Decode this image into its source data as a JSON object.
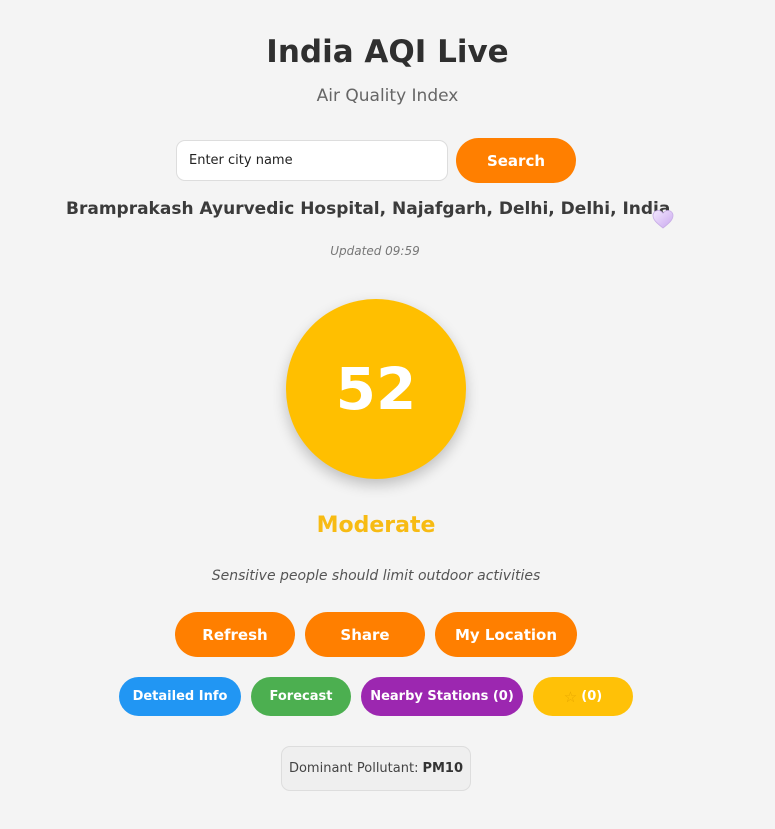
{
  "header": {
    "title": "India AQI Live",
    "subtitle": "Air Quality Index"
  },
  "search": {
    "placeholder": "Enter city name",
    "button_label": "Search"
  },
  "station": {
    "name": "Bramprakash Ayurvedic Hospital, Najafgarh, Delhi, Delhi, India",
    "favorite_icon": "heart-icon",
    "updated": "Updated 09:59"
  },
  "aqi": {
    "value": "52",
    "level": "Moderate",
    "advice": "Sensitive people should limit outdoor activities",
    "color": "#ffbf00",
    "level_color": "#f7bb13"
  },
  "actions": {
    "refresh": "Refresh",
    "share": "Share",
    "my_location": "My Location"
  },
  "links": {
    "detailed_info": "Detailed Info",
    "forecast": "Forecast",
    "nearby_stations": "Nearby Stations (0)",
    "favorites_icon": "star-icon",
    "favorites_star": "☆",
    "favorites_count": "(0)"
  },
  "pollutant": {
    "label": "Dominant Pollutant:",
    "value": "PM10"
  },
  "colors": {
    "primary": "#ff7f00",
    "blue": "#2196f3",
    "green": "#4caf50",
    "purple": "#9c27b0",
    "amber": "#ffc107",
    "background": "#f4f4f4"
  }
}
